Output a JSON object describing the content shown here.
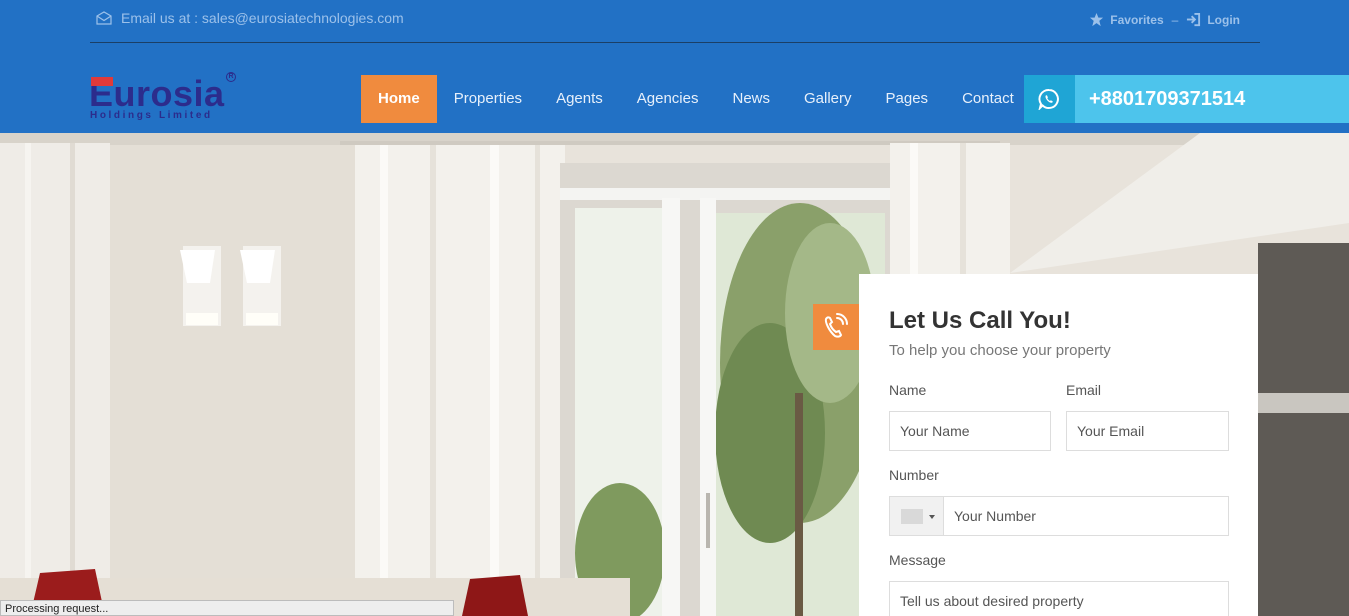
{
  "topbar": {
    "email_text": "Email us at : sales@eurosiatechnologies.com",
    "favorites_label": "Favorites",
    "separator": "–",
    "login_label": "Login"
  },
  "logo": {
    "name": "Eurosia",
    "tagline": "Holdings Limited",
    "registered_mark": "R"
  },
  "nav": {
    "items": [
      {
        "label": "Home",
        "active": true
      },
      {
        "label": "Properties"
      },
      {
        "label": "Agents"
      },
      {
        "label": "Agencies"
      },
      {
        "label": "News"
      },
      {
        "label": "Gallery"
      },
      {
        "label": "Pages"
      },
      {
        "label": "Contact"
      }
    ]
  },
  "call": {
    "phone": "+8801709371514",
    "icon": "whatsapp-icon"
  },
  "form": {
    "title": "Let Us Call You!",
    "subtitle": "To help you choose your property",
    "name_label": "Name",
    "name_placeholder": "Your Name",
    "email_label": "Email",
    "email_placeholder": "Your Email",
    "number_label": "Number",
    "number_placeholder": "Your Number",
    "message_label": "Message",
    "message_placeholder": "Tell us about desired property"
  },
  "status_bar": {
    "text": "Processing request..."
  },
  "colors": {
    "header_blue": "#2271c5",
    "accent_orange": "#f08b3e",
    "call_cyan": "#4dc4ec",
    "logo_navy": "#2c2c8c"
  }
}
